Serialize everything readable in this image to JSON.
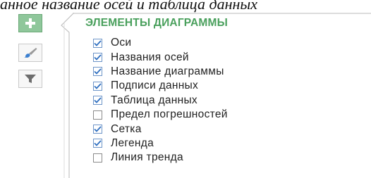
{
  "caption": {
    "text": "анное название осей и таблица данных"
  },
  "sidebar": {
    "buttons": [
      {
        "icon": "plus-icon",
        "active": true
      },
      {
        "icon": "brush-icon",
        "active": false
      },
      {
        "icon": "filter-icon",
        "active": false
      }
    ]
  },
  "panel": {
    "title": "ЭЛЕМЕНТЫ ДИАГРАММЫ",
    "items": [
      {
        "label": "Оси",
        "checked": true
      },
      {
        "label": "Названия осей",
        "checked": true
      },
      {
        "label": "Название диаграммы",
        "checked": true
      },
      {
        "label": "Подписи данных",
        "checked": true
      },
      {
        "label": "Таблица данных",
        "checked": true
      },
      {
        "label": "Предел погрешностей",
        "checked": false
      },
      {
        "label": "Сетка",
        "checked": true
      },
      {
        "label": "Легенда",
        "checked": true
      },
      {
        "label": "Линия тренда",
        "checked": false
      }
    ]
  },
  "colors": {
    "accent_green": "#4aa05d",
    "active_button": "#8fc79b",
    "checkmark_blue": "#2f6fc0"
  }
}
